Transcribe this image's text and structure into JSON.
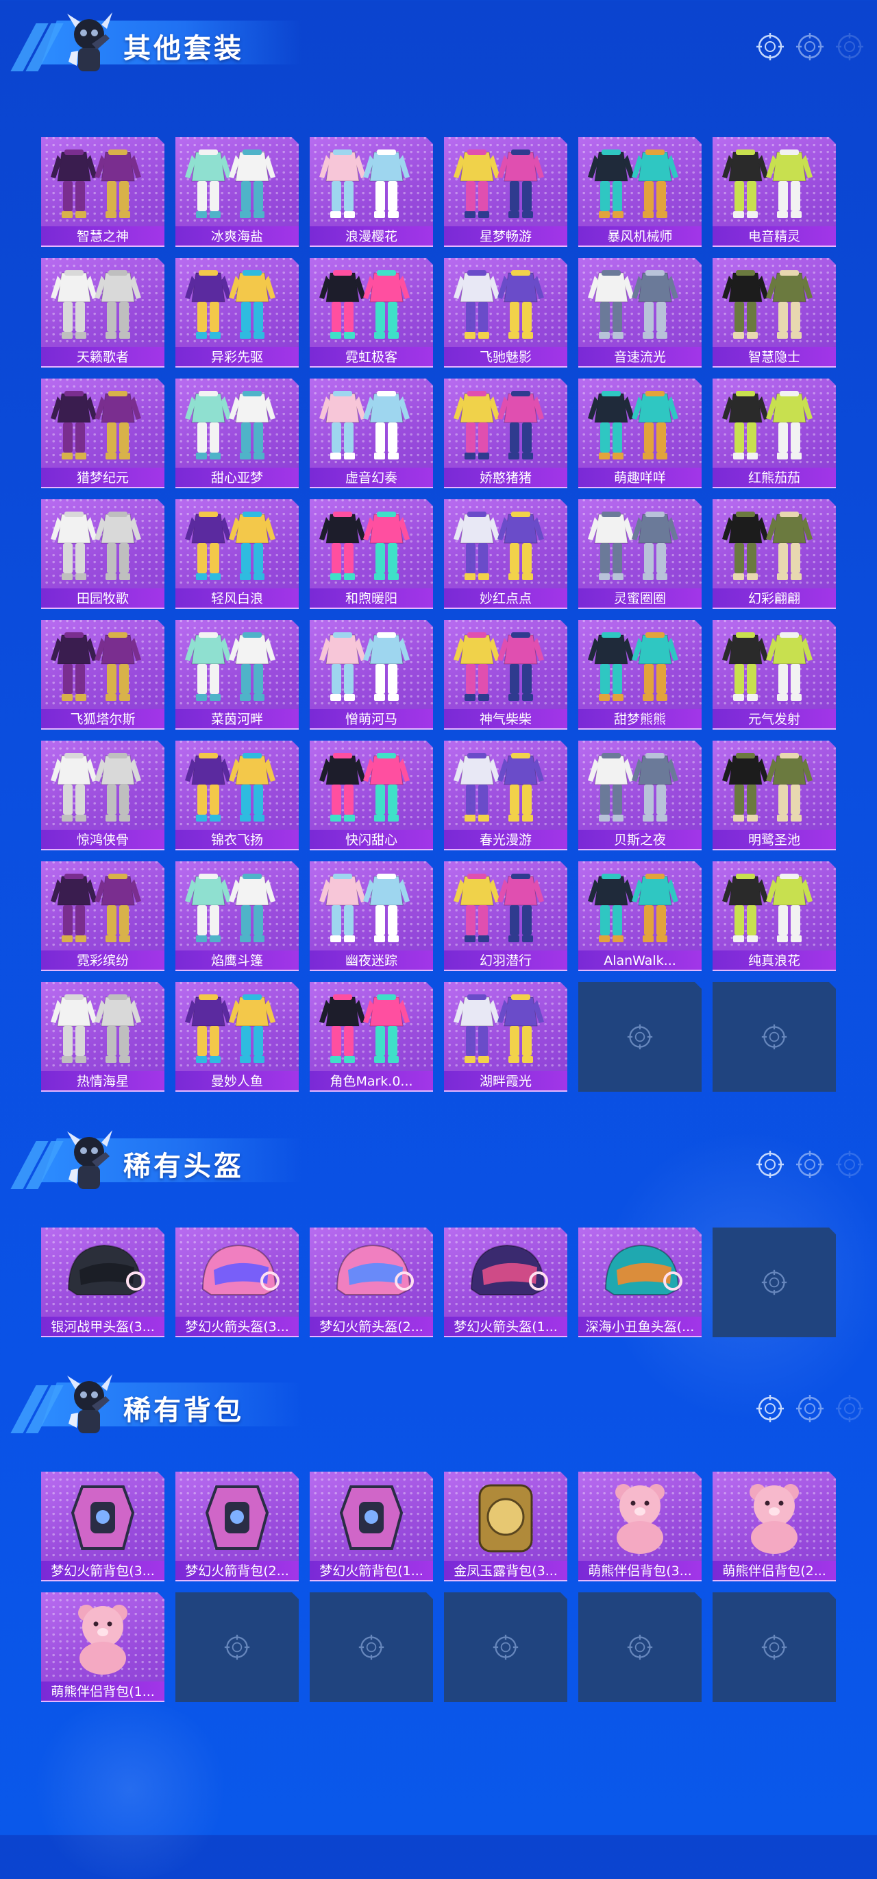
{
  "sections": [
    {
      "title": "其他套装",
      "items": [
        "智慧之神",
        "冰爽海盐",
        "浪漫樱花",
        "星梦畅游",
        "暴风机械师",
        "电音精灵",
        "天籁歌者",
        "异彩先驱",
        "霓虹极客",
        "飞驰魅影",
        "音速流光",
        "智慧隐士",
        "猎梦纪元",
        "甜心亚梦",
        "虚音幻奏",
        "娇憨猪猪",
        "萌趣咩咩",
        "红熊茄茄",
        "田园牧歌",
        "轻风白浪",
        "和煦暖阳",
        "妙红点点",
        "灵蜜圈圈",
        "幻彩翩翩",
        "飞狐塔尔斯",
        "菜茵河畔",
        "憎萌河马",
        "神气柴柴",
        "甜梦熊熊",
        "元气发射",
        "惊鸿侠骨",
        "锦衣飞扬",
        "快闪甜心",
        "春光漫游",
        "贝斯之夜",
        "明鹭圣池",
        "霓彩缤纷",
        "焰鹰斗篷",
        "幽夜迷踪",
        "幻羽潜行",
        "AlanWalk...",
        "纯真浪花",
        "热情海星",
        "曼妙人鱼",
        "角色Mark.0...",
        "湖畔霞光"
      ],
      "empty_slots": 2
    },
    {
      "title": "稀有头盔",
      "items": [
        "银河战甲头盔(3...",
        "梦幻火箭头盔(3...",
        "梦幻火箭头盔(2...",
        "梦幻火箭头盔(1...",
        "深海小丑鱼头盔(..."
      ],
      "empty_slots": 1
    },
    {
      "title": "稀有背包",
      "items": [
        "梦幻火箭背包(3...",
        "梦幻火箭背包(2...",
        "梦幻火箭背包(1...",
        "金凤玉露背包(3...",
        "萌熊伴侣背包(3...",
        "萌熊伴侣背包(2...",
        "萌熊伴侣背包(1..."
      ],
      "empty_slots": 5
    }
  ],
  "icons": {
    "header": [
      "mascot-icon",
      "crosshair-icon"
    ],
    "empty": "crosshair-icon"
  },
  "colors": {
    "background": "#0b4fe0",
    "card": "#a65ae6",
    "label": "#8a30de",
    "empty_card": "#20447f"
  }
}
